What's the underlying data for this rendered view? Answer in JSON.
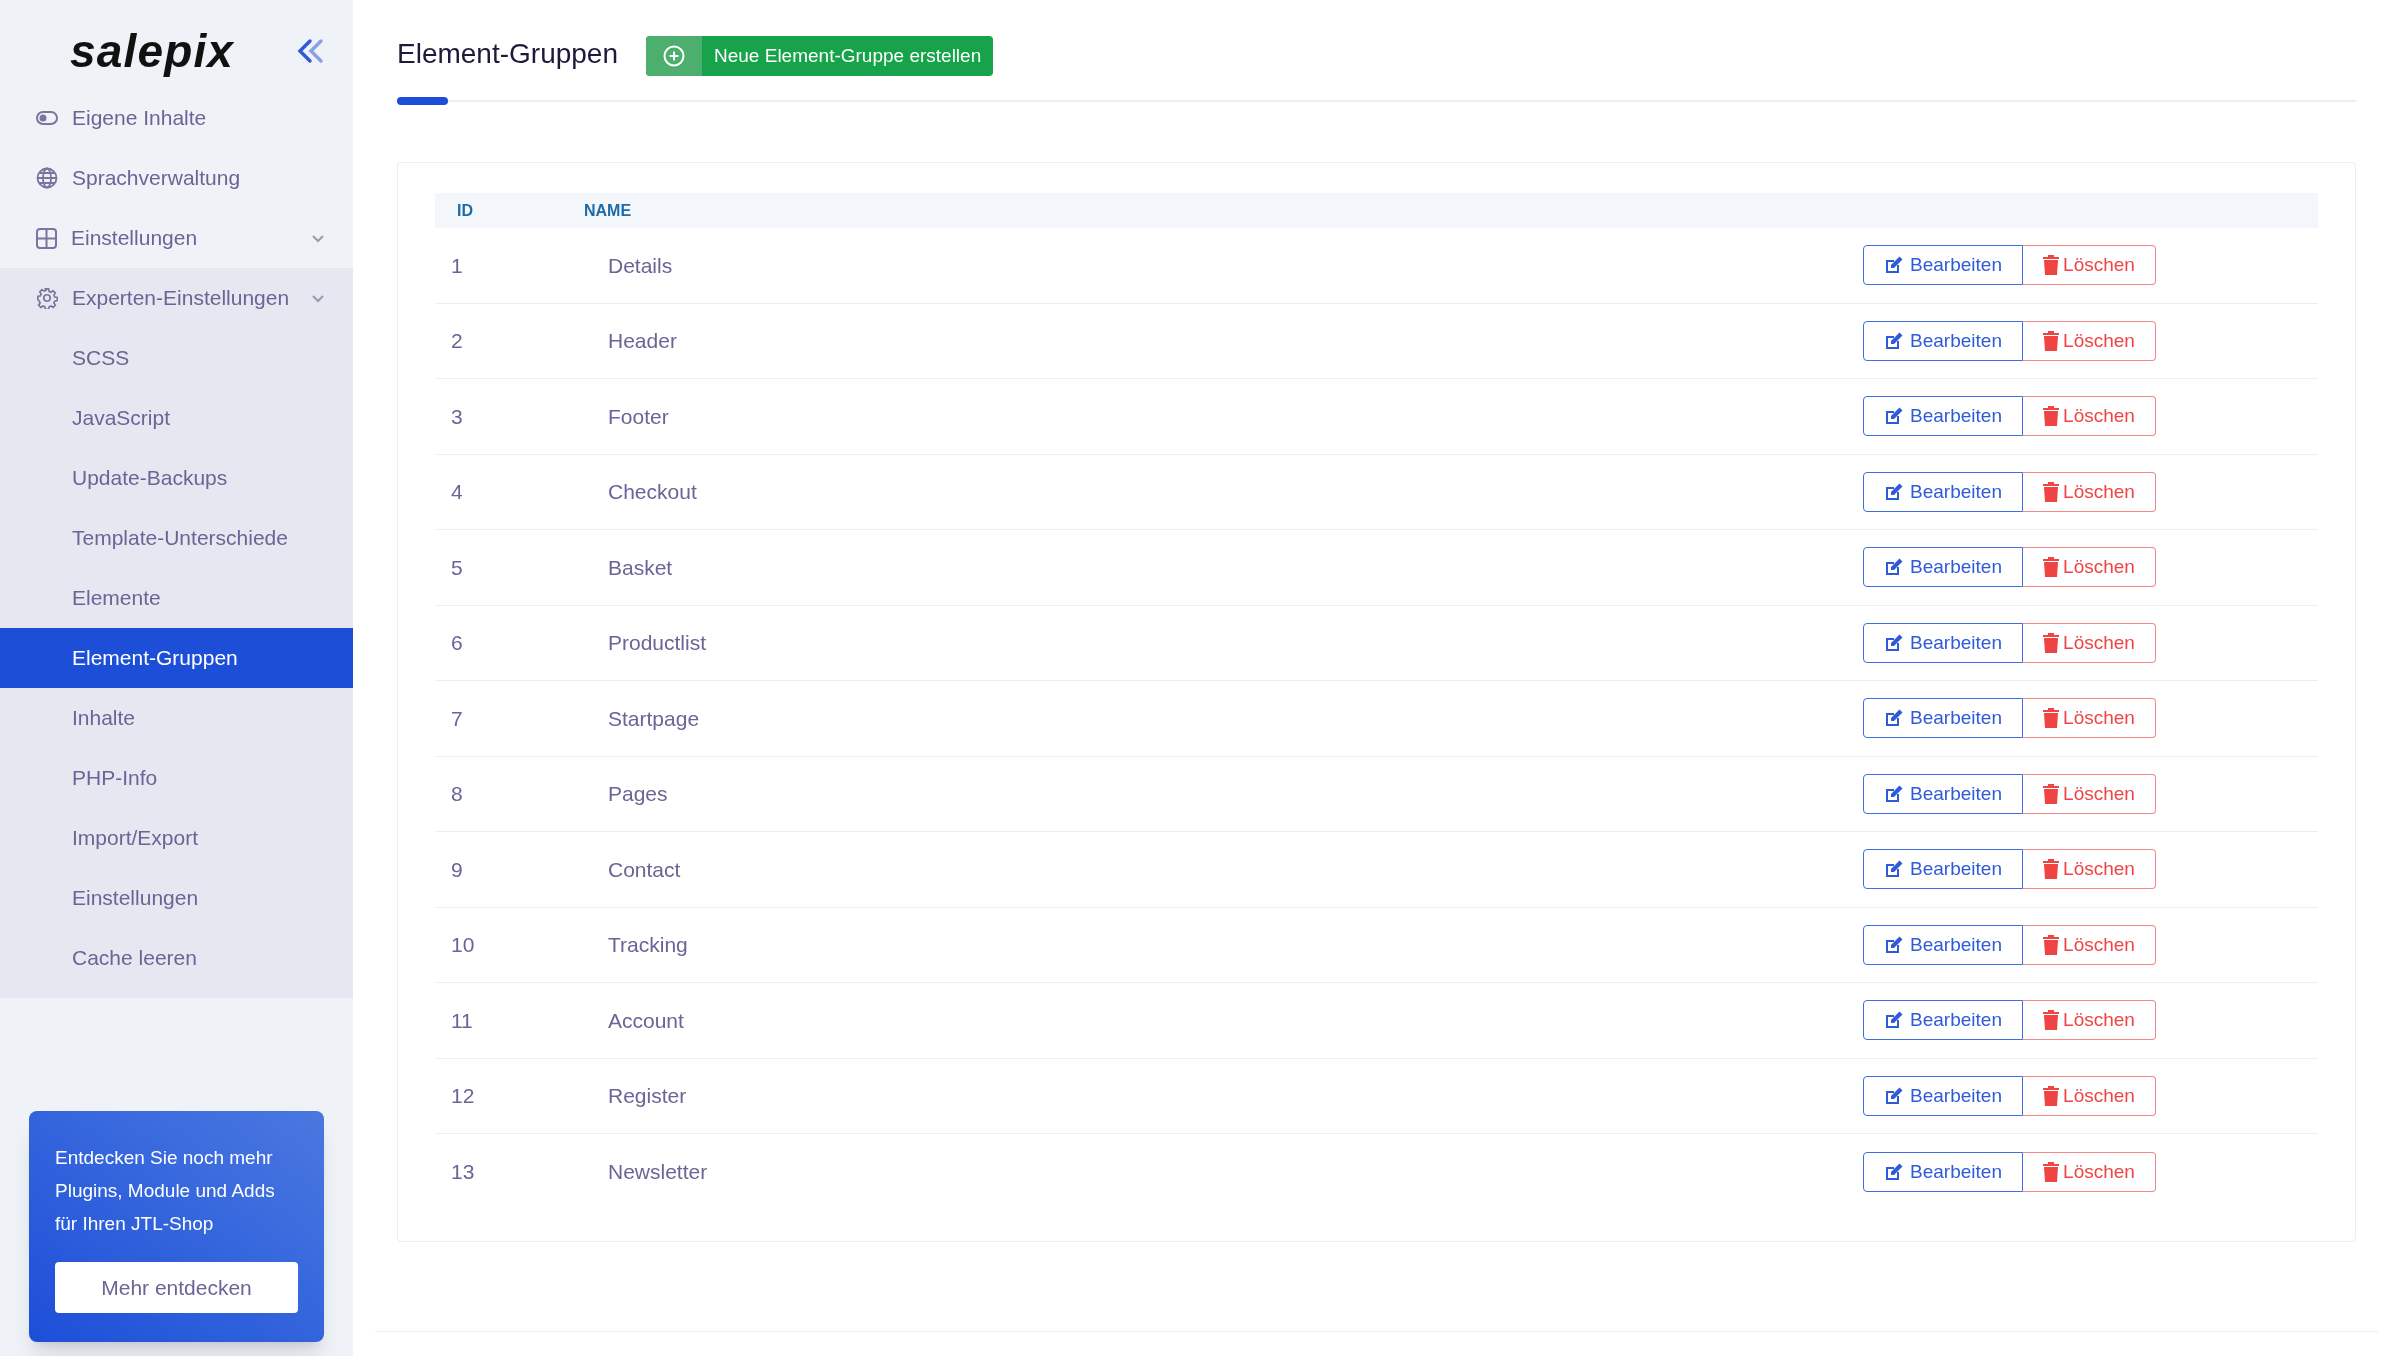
{
  "sidebar": {
    "logo": "salepix",
    "items": [
      {
        "label": "Eigene Inhalte",
        "kind": "link"
      },
      {
        "label": "Sprachverwaltung",
        "kind": "link"
      },
      {
        "label": "Einstellungen",
        "kind": "group"
      },
      {
        "label": "Experten-Einstellungen",
        "kind": "group",
        "children": [
          {
            "label": "SCSS",
            "selected": false
          },
          {
            "label": "JavaScript",
            "selected": false
          },
          {
            "label": "Update-Backups",
            "selected": false
          },
          {
            "label": "Template-Unterschiede",
            "selected": false
          },
          {
            "label": "Elemente",
            "selected": false
          },
          {
            "label": "Element-Gruppen",
            "selected": true
          },
          {
            "label": "Inhalte",
            "selected": false
          },
          {
            "label": "PHP-Info",
            "selected": false
          },
          {
            "label": "Import/Export",
            "selected": false
          },
          {
            "label": "Einstellungen",
            "selected": false
          },
          {
            "label": "Cache leeren",
            "selected": false
          }
        ]
      }
    ],
    "promo": {
      "text": "Entdecken Sie noch mehr Plugins, Module und Adds für Ihren JTL-Shop",
      "button": "Mehr entdecken"
    }
  },
  "header": {
    "title": "Element-Gruppen",
    "button": "Neue Element-Gruppe erstellen"
  },
  "table": {
    "columns": [
      "ID",
      "NAME"
    ],
    "rows": [
      {
        "id": "1",
        "name": "Details",
        "edit": "Bearbeiten",
        "delete": "Löschen"
      },
      {
        "id": "2",
        "name": "Header",
        "edit": "Bearbeiten",
        "delete": "Löschen"
      },
      {
        "id": "3",
        "name": "Footer",
        "edit": "Bearbeiten",
        "delete": "Löschen"
      },
      {
        "id": "4",
        "name": "Checkout",
        "edit": "Bearbeiten",
        "delete": "Löschen"
      },
      {
        "id": "5",
        "name": "Basket",
        "edit": "Bearbeiten",
        "delete": "Löschen"
      },
      {
        "id": "6",
        "name": "Productlist",
        "edit": "Bearbeiten",
        "delete": "Löschen"
      },
      {
        "id": "7",
        "name": "Startpage",
        "edit": "Bearbeiten",
        "delete": "Löschen"
      },
      {
        "id": "8",
        "name": "Pages",
        "edit": "Bearbeiten",
        "delete": "Löschen"
      },
      {
        "id": "9",
        "name": "Contact",
        "edit": "Bearbeiten",
        "delete": "Löschen"
      },
      {
        "id": "10",
        "name": "Tracking",
        "edit": "Bearbeiten",
        "delete": "Löschen"
      },
      {
        "id": "11",
        "name": "Account",
        "edit": "Bearbeiten",
        "delete": "Löschen"
      },
      {
        "id": "12",
        "name": "Register",
        "edit": "Bearbeiten",
        "delete": "Löschen"
      },
      {
        "id": "13",
        "name": "Newsletter",
        "edit": "Bearbeiten",
        "delete": "Löschen"
      }
    ]
  }
}
